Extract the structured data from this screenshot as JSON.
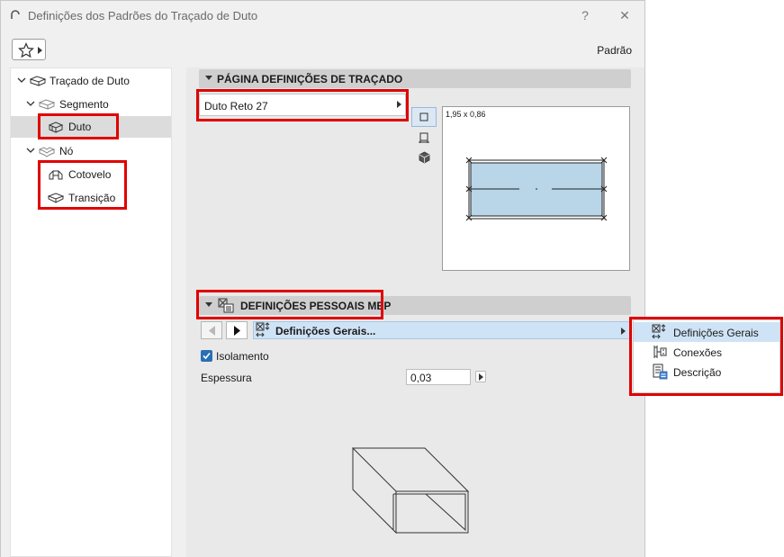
{
  "window": {
    "title": "Definições dos Padrões do Traçado de Duto",
    "help_glyph": "?",
    "close_glyph": "✕",
    "default_label": "Padrão"
  },
  "tree": {
    "items": [
      {
        "label": "Traçado de Duto",
        "icon": "duct-route-icon",
        "expanded": true
      },
      {
        "label": "Segmento",
        "icon": "segment-icon",
        "expanded": true
      },
      {
        "label": "Duto",
        "icon": "duct-icon",
        "selected": true
      },
      {
        "label": "Nó",
        "icon": "node-icon",
        "expanded": true
      },
      {
        "label": "Cotovelo",
        "icon": "elbow-icon"
      },
      {
        "label": "Transição",
        "icon": "transition-icon"
      }
    ]
  },
  "route_page": {
    "header": "PÁGINA DEFINIÇÕES DE TRAÇADO",
    "dropdown_value": "Duto Reto 27",
    "preview_dimension": "1,95 x 0,86",
    "view_buttons": [
      "plan-view-icon",
      "section-view-icon",
      "3d-view-icon"
    ]
  },
  "mep_page": {
    "header": "DEFINIÇÕES PESSOAIS MEP",
    "selector_value": "Definições Gerais...",
    "insulation_label": "Isolamento",
    "insulation_checked": true,
    "thickness_label": "Espessura",
    "thickness_value": "0,03"
  },
  "menu": {
    "items": [
      {
        "label": "Definições Gerais",
        "icon": "general-settings-icon",
        "highlighted": true
      },
      {
        "label": "Conexões",
        "icon": "connections-icon"
      },
      {
        "label": "Descrição",
        "icon": "description-icon"
      }
    ]
  },
  "colors": {
    "highlight_box": "#e00000",
    "selection_blue": "#cfe3f6",
    "checkbox_blue": "#2a6fb5",
    "preview_fill": "#b8d6e8"
  }
}
